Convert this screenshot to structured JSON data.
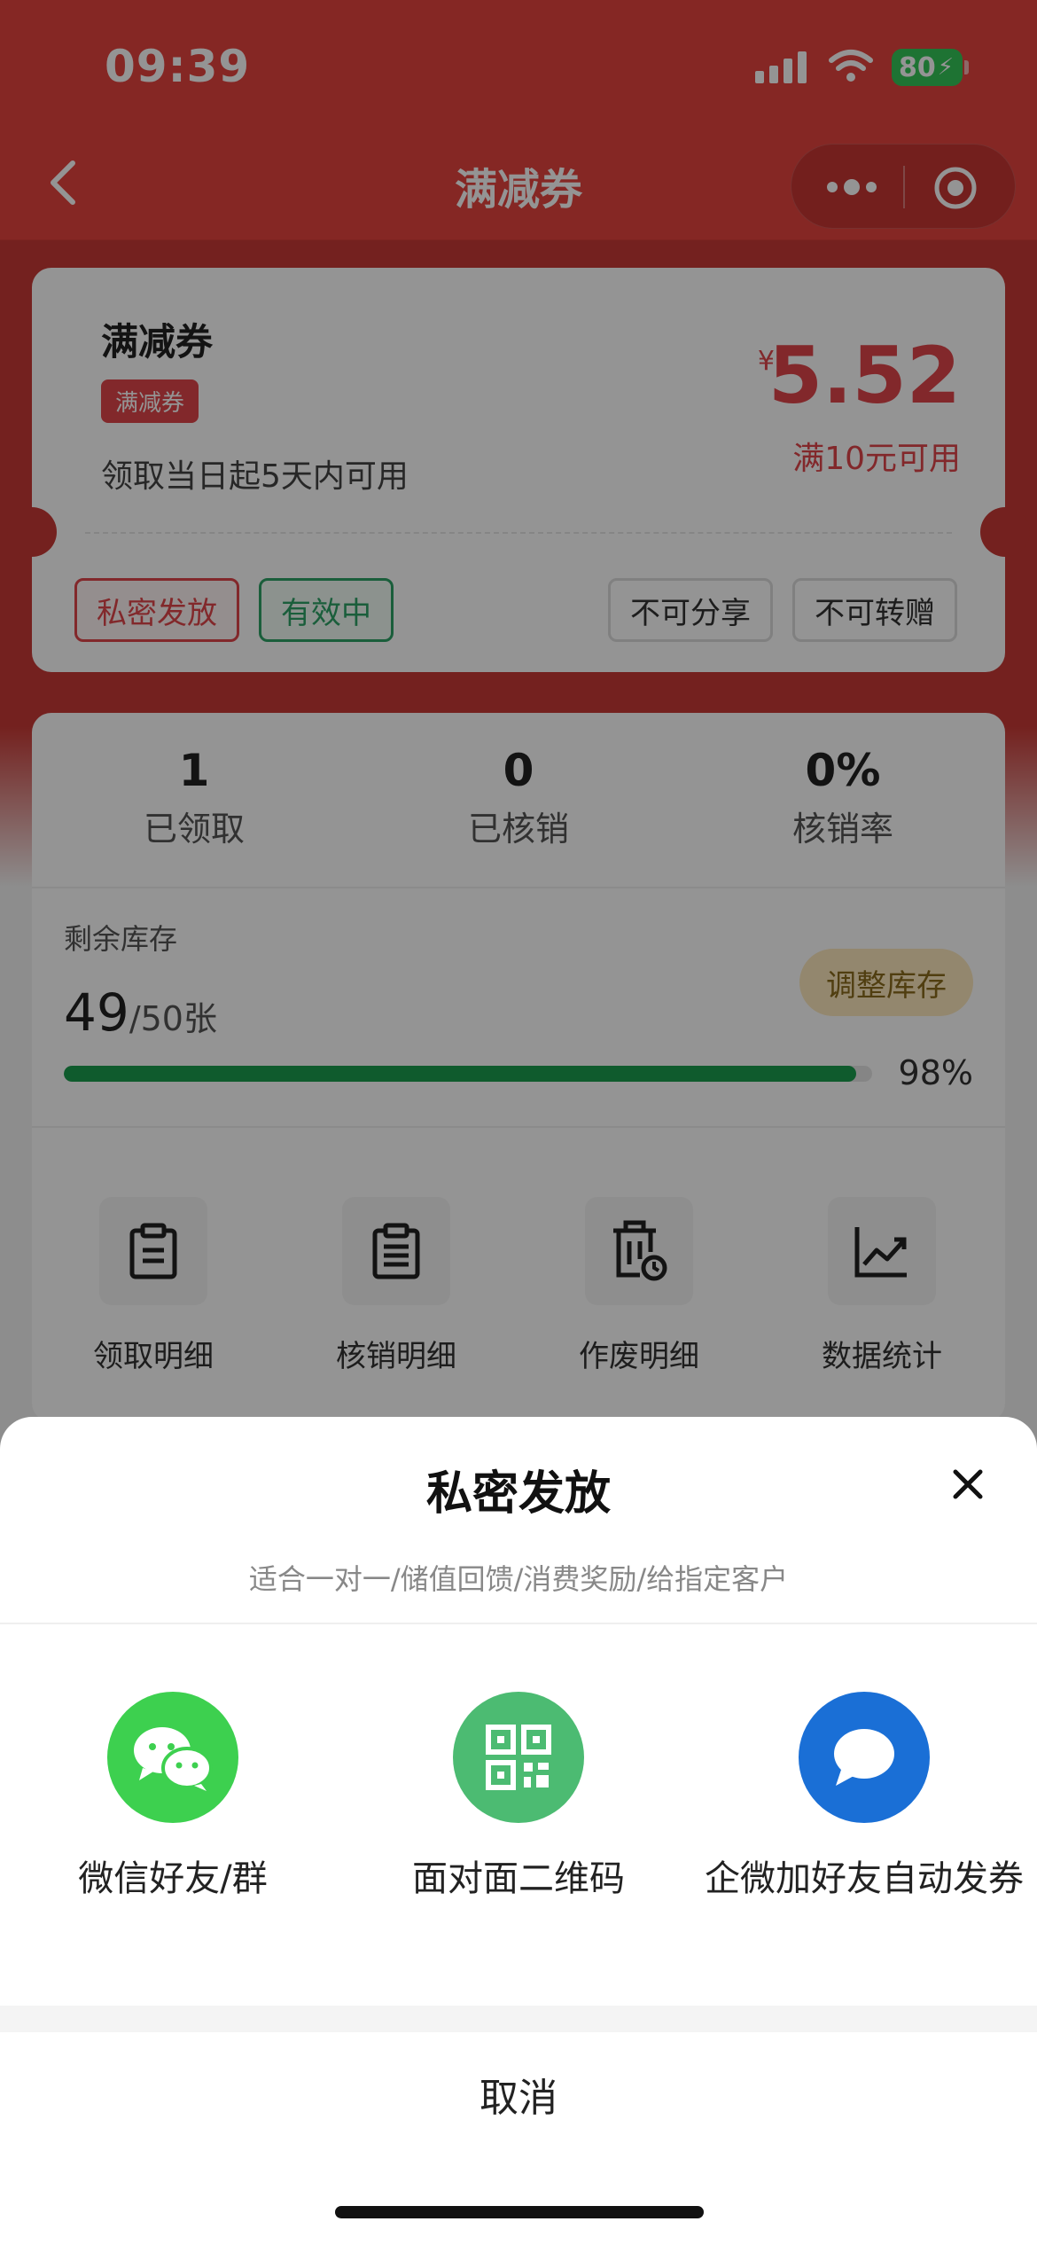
{
  "status_bar": {
    "time": "09:39",
    "battery": "80"
  },
  "nav": {
    "title": "满减券"
  },
  "coupon": {
    "title": "满减券",
    "tag": "满减券",
    "validity": "领取当日起5天内可用",
    "currency": "¥",
    "amount": "5.52",
    "condition": "满10元可用",
    "badges": [
      "私密发放",
      "有效中",
      "不可分享",
      "不可转赠"
    ]
  },
  "stats": {
    "items": [
      {
        "value": "1",
        "label": "已领取"
      },
      {
        "value": "0",
        "label": "已核销"
      },
      {
        "value": "0%",
        "label": "核销率"
      }
    ],
    "stock_label": "剩余库存",
    "stock_remaining": "49",
    "stock_total": "/50张",
    "adjust_label": "调整库存",
    "progress_percent": "98%",
    "progress_value": 0.98
  },
  "tools": [
    {
      "label": "领取明细",
      "icon": "clipboard-icon"
    },
    {
      "label": "核销明细",
      "icon": "document-list-icon"
    },
    {
      "label": "作废明细",
      "icon": "trash-clock-icon"
    },
    {
      "label": "数据统计",
      "icon": "chart-trend-icon"
    }
  ],
  "sheet": {
    "title": "私密发放",
    "subtitle": "适合一对一/储值回馈/消费奖励/给指定客户",
    "options": [
      {
        "label": "微信好友/群",
        "icon": "wechat-icon",
        "color": "#3dd04f"
      },
      {
        "label": "面对面二维码",
        "icon": "qr-code-icon",
        "color": "#4cbb72"
      },
      {
        "label": "企微加好友自动发券",
        "icon": "chat-bubble-icon",
        "color": "#1a6fd6"
      }
    ],
    "cancel": "取消"
  },
  "colors": {
    "brand_red": "#e6443f",
    "price_red": "#e0464a",
    "progress_green": "#1a9d4e"
  }
}
